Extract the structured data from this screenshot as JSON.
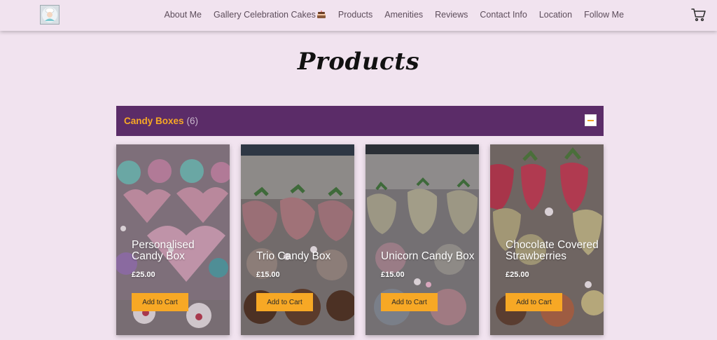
{
  "header": {
    "nav": [
      "About Me",
      "Gallery Celebration Cakes",
      "Products",
      "Amenities",
      "Reviews",
      "Contact Info",
      "Location",
      "Follow Me"
    ],
    "logo_icon": "baker-avatar-icon",
    "cake_icon": "cake-icon",
    "cart_icon": "cart-icon"
  },
  "page": {
    "title": "Products"
  },
  "category": {
    "name": "Candy Boxes",
    "count": "(6)",
    "toggle_icon": "minus-icon",
    "accent": "#f7a825",
    "bar_color": "#5b2c68"
  },
  "products": [
    {
      "name": "Personalised Candy Box",
      "price": "£25.00",
      "button": "Add to Cart"
    },
    {
      "name": "Trio Candy Box",
      "price": "£15.00",
      "button": "Add to Cart"
    },
    {
      "name": "Unicorn Candy Box",
      "price": "£15.00",
      "button": "Add to Cart"
    },
    {
      "name": "Chocolate Covered Strawberries",
      "price": "£25.00",
      "button": "Add to Cart"
    }
  ]
}
